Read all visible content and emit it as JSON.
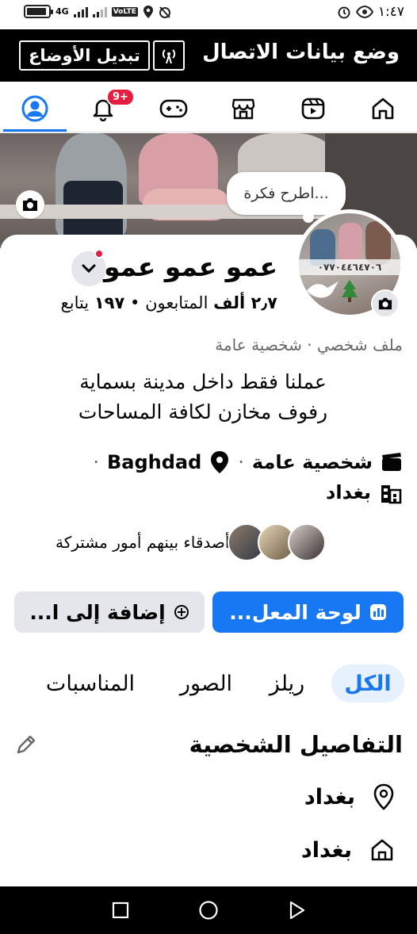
{
  "status_bar": {
    "time": "١:٤٧",
    "network": "4G",
    "volte": "VoLTE"
  },
  "data_banner": {
    "title": "وضع بيانات الاتصال",
    "switch_label": "تبديل الأوضاع"
  },
  "nav": {
    "notifications_badge": "9+",
    "active_tab": "profile"
  },
  "cover": {
    "thought_prompt": "اطرح فكرة..."
  },
  "avatar": {
    "phone_text": "٠٧٧٠٤٤٦٤٧٠٦"
  },
  "profile": {
    "name": "عمو عمو عمو",
    "stats": {
      "followers_count": "٢٫٧ ألف",
      "followers_label": "المتابعون",
      "following_count": "١٩٧",
      "following_label": "يتابع",
      "separator": "•"
    },
    "category": "ملف شخصي · شخصية عامة",
    "bio_line1": "عملنا فقط داخل مدينة بسماية",
    "bio_line2": "رفوف مخازن لكافة المساحات",
    "info": {
      "type": "شخصية عامة",
      "location": "Baghdad",
      "city": "بغداد",
      "separator": "·"
    },
    "mutual_friends_text": "أصدقاء بينهم أمور مشتركة"
  },
  "actions": {
    "dashboard_label": "لوحة المعل...",
    "add_to_label": "إضافة إلى ا..."
  },
  "tabs": [
    {
      "label": "الكل",
      "active": true
    },
    {
      "label": "ريلز",
      "active": false
    },
    {
      "label": "الصور",
      "active": false
    },
    {
      "label": "المناسبات",
      "active": false
    }
  ],
  "details": {
    "title": "التفاصيل الشخصية",
    "items": [
      {
        "icon": "location-icon",
        "label": "بغداد"
      },
      {
        "icon": "home-icon",
        "label": "بغداد"
      }
    ]
  },
  "colors": {
    "accent": "#1877f2",
    "badge": "#e41e3f",
    "secondary_bg": "#e4e6eb"
  }
}
